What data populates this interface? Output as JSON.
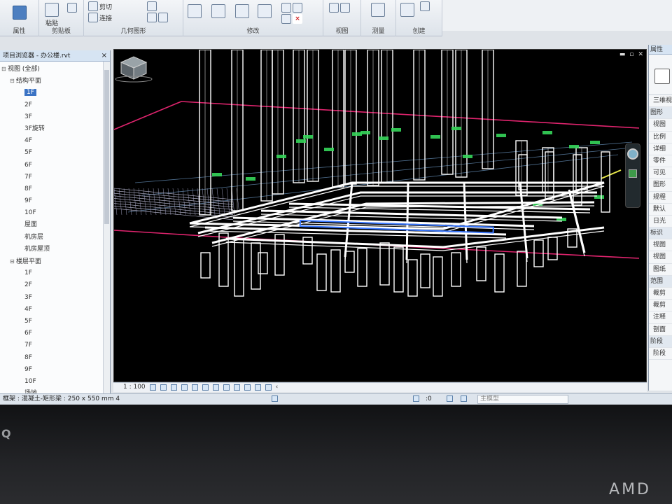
{
  "ribbon": {
    "groups": [
      "属性",
      "剪贴板",
      "几何图形",
      "修改",
      "视图",
      "测量",
      "创建"
    ],
    "buttons": {
      "paste": "粘贴",
      "cut": "剪切",
      "join": "连接"
    }
  },
  "browser": {
    "title": "项目浏览器 - 办公楼.rvt",
    "close": "×",
    "nodes": [
      {
        "label": "视图 (全部)",
        "indent": 0,
        "exp": "⊟"
      },
      {
        "label": "结构平面",
        "indent": 1,
        "exp": "⊟"
      },
      {
        "label": "1F",
        "indent": 2,
        "exp": "",
        "selected": true
      },
      {
        "label": "2F",
        "indent": 2,
        "exp": ""
      },
      {
        "label": "3F",
        "indent": 2,
        "exp": ""
      },
      {
        "label": "3F旋转",
        "indent": 2,
        "exp": ""
      },
      {
        "label": "4F",
        "indent": 2,
        "exp": ""
      },
      {
        "label": "5F",
        "indent": 2,
        "exp": ""
      },
      {
        "label": "6F",
        "indent": 2,
        "exp": ""
      },
      {
        "label": "7F",
        "indent": 2,
        "exp": ""
      },
      {
        "label": "8F",
        "indent": 2,
        "exp": ""
      },
      {
        "label": "9F",
        "indent": 2,
        "exp": ""
      },
      {
        "label": "10F",
        "indent": 2,
        "exp": ""
      },
      {
        "label": "屋面",
        "indent": 2,
        "exp": ""
      },
      {
        "label": "机房层",
        "indent": 2,
        "exp": ""
      },
      {
        "label": "机房屋顶",
        "indent": 2,
        "exp": ""
      },
      {
        "label": "楼层平面",
        "indent": 1,
        "exp": "⊟"
      },
      {
        "label": "1F",
        "indent": 2,
        "exp": ""
      },
      {
        "label": "2F",
        "indent": 2,
        "exp": ""
      },
      {
        "label": "3F",
        "indent": 2,
        "exp": ""
      },
      {
        "label": "4F",
        "indent": 2,
        "exp": ""
      },
      {
        "label": "5F",
        "indent": 2,
        "exp": ""
      },
      {
        "label": "6F",
        "indent": 2,
        "exp": ""
      },
      {
        "label": "7F",
        "indent": 2,
        "exp": ""
      },
      {
        "label": "8F",
        "indent": 2,
        "exp": ""
      },
      {
        "label": "9F",
        "indent": 2,
        "exp": ""
      },
      {
        "label": "10F",
        "indent": 2,
        "exp": ""
      },
      {
        "label": "场地",
        "indent": 2,
        "exp": ""
      }
    ]
  },
  "viewbar": {
    "scale": "1 : 100"
  },
  "status": {
    "text": "框架 : 混凝土-矩形梁 : 250 x 550 mm 4",
    "zero": ":0",
    "model": "主模型"
  },
  "props": {
    "title": "属性",
    "rows": [
      {
        "label": "三维视",
        "group": false
      },
      {
        "label": "图形",
        "group": true
      },
      {
        "label": "视图",
        "group": false
      },
      {
        "label": "比例",
        "group": false
      },
      {
        "label": "详细",
        "group": false
      },
      {
        "label": "零件",
        "group": false
      },
      {
        "label": "可见",
        "group": false
      },
      {
        "label": "图形",
        "group": false
      },
      {
        "label": "规程",
        "group": false
      },
      {
        "label": "默认",
        "group": false
      },
      {
        "label": "日光",
        "group": false
      },
      {
        "label": "标识",
        "group": true
      },
      {
        "label": "视图",
        "group": false
      },
      {
        "label": "视图",
        "group": false
      },
      {
        "label": "图纸",
        "group": false
      },
      {
        "label": "范围",
        "group": true
      },
      {
        "label": "裁剪",
        "group": false
      },
      {
        "label": "裁剪",
        "group": false
      },
      {
        "label": "注释",
        "group": false
      },
      {
        "label": "剖面",
        "group": false
      },
      {
        "label": "阶段",
        "group": true
      },
      {
        "label": "阶段",
        "group": false
      }
    ]
  },
  "bezel": {
    "brand": "AMD",
    "q": "Q"
  },
  "colors": {
    "viewport_bg": "#000000",
    "structure": "#ffffff",
    "level_line": "#e0246e",
    "grid_marker": "#35d65a",
    "selection": "#3a78ff"
  }
}
